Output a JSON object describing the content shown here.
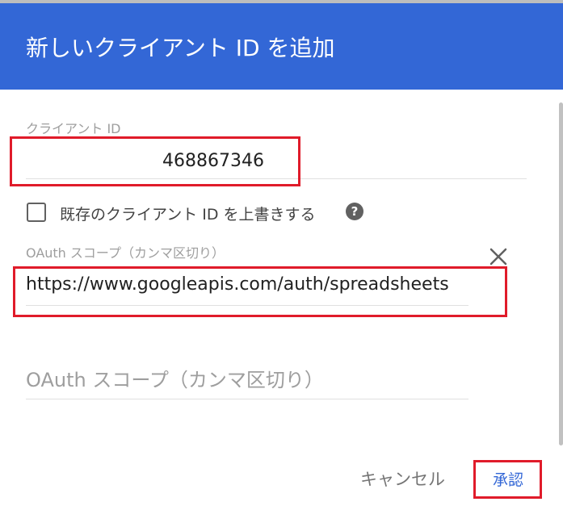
{
  "dialog": {
    "title": "新しいクライアント ID を追加"
  },
  "client_id": {
    "label": "クライアント ID",
    "value": "468867346"
  },
  "overwrite": {
    "label": "既存のクライアント ID を上書きする",
    "checked": false
  },
  "scopes": {
    "label": "OAuth スコープ（カンマ区切り）",
    "items": [
      {
        "value": "https://www.googleapis.com/auth/spreadsheets"
      }
    ],
    "placeholder": "OAuth スコープ（カンマ区切り）"
  },
  "actions": {
    "cancel_label": "キャンセル",
    "approve_label": "承認"
  },
  "colors": {
    "header": "#3367d6",
    "highlight": "#e01b2a",
    "primary_text": "#3367d6"
  },
  "icons": {
    "help": "help-circle-icon",
    "close": "close-icon"
  }
}
